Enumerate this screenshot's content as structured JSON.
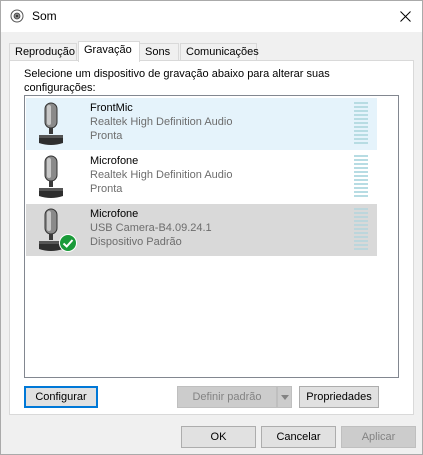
{
  "window": {
    "title": "Som",
    "icon": "speaker-icon",
    "close_icon": "close-icon"
  },
  "tabs": [
    {
      "label": "Reprodução",
      "active": false
    },
    {
      "label": "Gravação",
      "active": true
    },
    {
      "label": "Sons",
      "active": false
    },
    {
      "label": "Comunicações",
      "active": false
    }
  ],
  "instructions": "Selecione um dispositivo de gravação abaixo para alterar suas configurações:",
  "devices": [
    {
      "name": "FrontMic",
      "driver": "Realtek High Definition Audio",
      "status": "Pronta",
      "state": "hover",
      "icon": "microphone-icon"
    },
    {
      "name": "Microfone",
      "driver": "Realtek High Definition Audio",
      "status": "Pronta",
      "state": "normal",
      "icon": "microphone-icon"
    },
    {
      "name": "Microfone",
      "driver": "USB Camera-B4.09.24.1",
      "status": "Dispositivo Padrão",
      "state": "selected",
      "icon": "microphone-icon",
      "default_badge_icon": "default-check-icon"
    }
  ],
  "buttons": {
    "configure": "Configurar",
    "set_default": "Definir padrão",
    "properties": "Propriedades",
    "ok": "OK",
    "cancel": "Cancelar",
    "apply": "Aplicar"
  },
  "colors": {
    "accent": "#0078d7",
    "hover_row": "#e5f3fb",
    "selected_row": "#d9d9d9",
    "default_check": "#1a9a39",
    "meter": "#b7dce3"
  }
}
